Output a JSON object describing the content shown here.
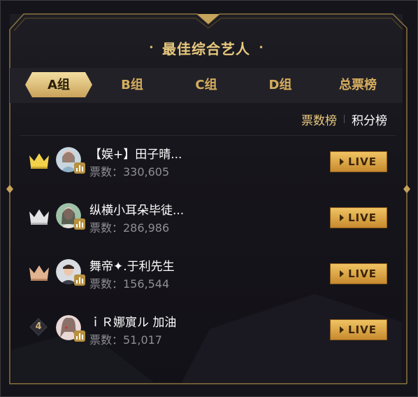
{
  "title": "最佳综合艺人",
  "tabs": [
    {
      "label": "A组",
      "active": true
    },
    {
      "label": "B组",
      "active": false
    },
    {
      "label": "C组",
      "active": false
    },
    {
      "label": "D组",
      "active": false
    },
    {
      "label": "总票榜",
      "active": false
    }
  ],
  "sort": {
    "votes_label": "票数榜",
    "points_label": "积分榜",
    "active": "votes"
  },
  "entries": [
    {
      "rank": "1",
      "rank_icon": "gold-crown-icon",
      "name": "【娱+】田子晴...",
      "votes": "票数：330,605",
      "live": "LIVE"
    },
    {
      "rank": "2",
      "rank_icon": "silver-crown-icon",
      "name": "纵横小耳朵毕徒...",
      "votes": "票数：286,986",
      "live": "LIVE"
    },
    {
      "rank": "3",
      "rank_icon": "bronze-crown-icon",
      "name": "舞帝✦.于利先生",
      "votes": "票数：156,544",
      "live": "LIVE"
    },
    {
      "rank": "4",
      "rank_icon": "diamond-badge-icon",
      "name": "ｉＲ娜賔ル 加油",
      "votes": "票数：51,017",
      "live": "LIVE"
    }
  ],
  "colors": {
    "gold": "#e8c97e",
    "tab_text": "#d6ad5e",
    "background": "#16151b",
    "gray_text": "#8f8e96"
  }
}
